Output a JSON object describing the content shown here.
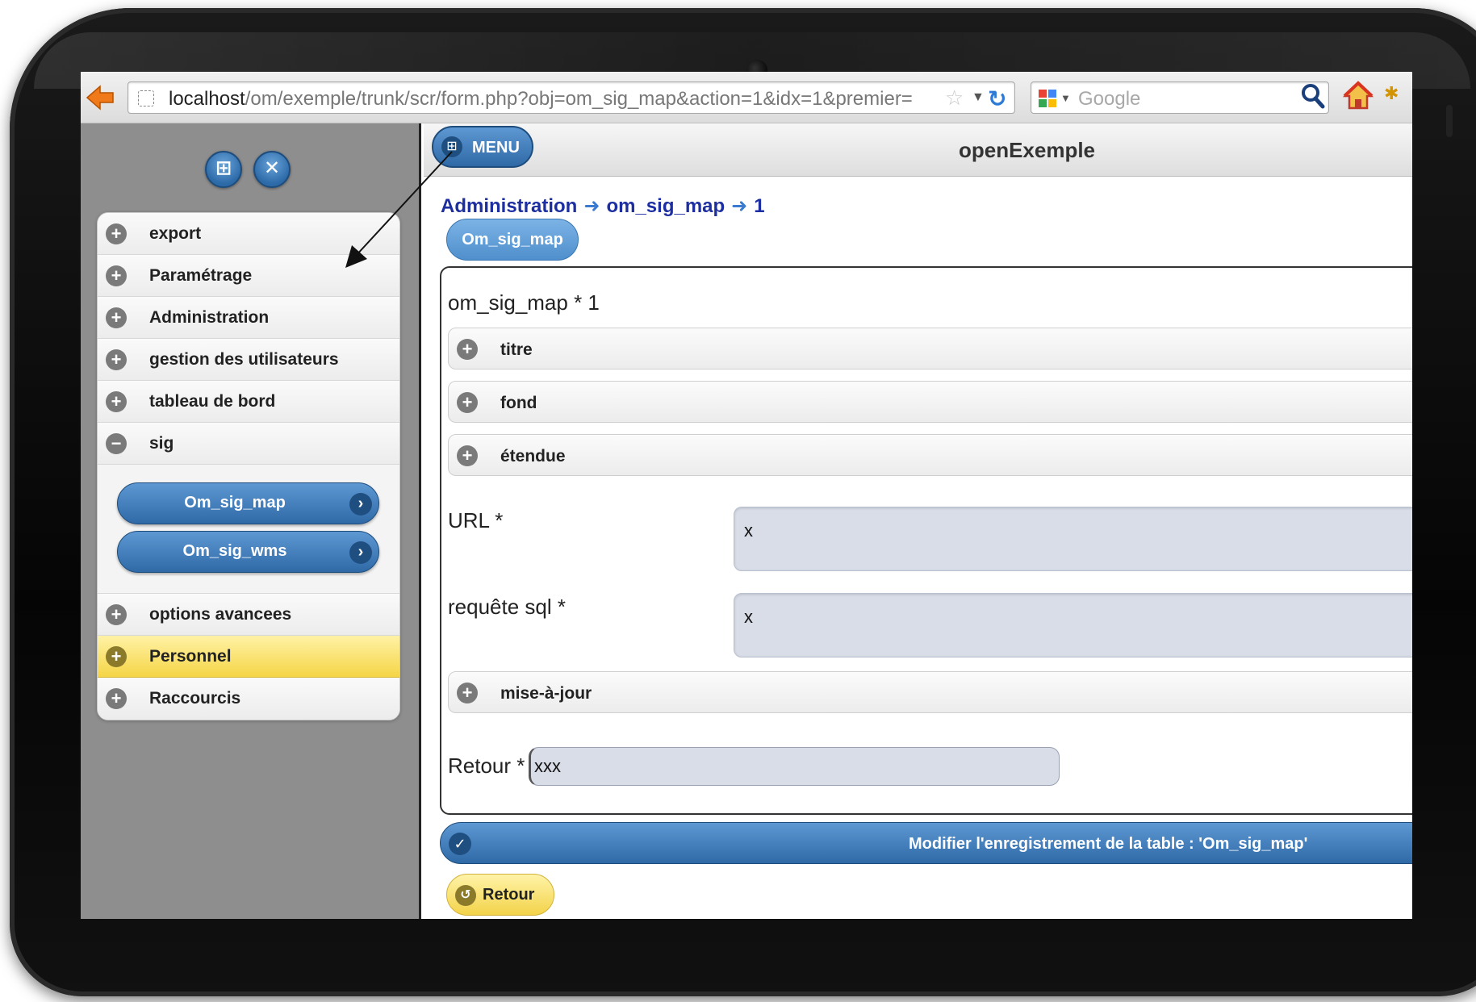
{
  "browser": {
    "url_host": "localhost",
    "url_path": "/om/exemple/trunk/scr/form.php?obj=om_sig_map&action=1&idx=1&premier=",
    "search_placeholder": "Google"
  },
  "app": {
    "menu_label": "MENU",
    "title": "openExemple"
  },
  "sidebar": {
    "items": [
      {
        "label": "export",
        "state": "collapsed"
      },
      {
        "label": "Paramétrage",
        "state": "collapsed"
      },
      {
        "label": "Administration",
        "state": "collapsed"
      },
      {
        "label": "gestion des utilisateurs",
        "state": "collapsed"
      },
      {
        "label": "tableau de bord",
        "state": "collapsed"
      },
      {
        "label": "sig",
        "state": "expanded"
      }
    ],
    "sub_items": [
      {
        "label": "Om_sig_map"
      },
      {
        "label": "Om_sig_wms"
      }
    ],
    "items_after": [
      {
        "label": "options avancees",
        "state": "collapsed"
      },
      {
        "label": "Personnel",
        "state": "collapsed",
        "highlight": true
      },
      {
        "label": "Raccourcis",
        "state": "collapsed"
      }
    ]
  },
  "breadcrumb": {
    "parts": [
      "Administration",
      "om_sig_map",
      "1"
    ]
  },
  "tab": {
    "label": "Om_sig_map"
  },
  "form": {
    "title": "om_sig_map * 1",
    "fieldsets": {
      "titre": "titre",
      "fond": "fond",
      "etendue": "étendue",
      "mise_a_jour": "mise-à-jour"
    },
    "url": {
      "label": "URL *",
      "value": "x"
    },
    "requete": {
      "label": "requête sql *",
      "value": "x"
    },
    "retour": {
      "label": "Retour *",
      "value": "xxx"
    }
  },
  "actions": {
    "submit_label": "Modifier l'enregistrement de la table : 'Om_sig_map'",
    "back_label": "Retour"
  },
  "colors": {
    "accent_blue": "#2f6aa7",
    "highlight_yellow": "#f5d546",
    "breadcrumb": "#1d2fa0"
  }
}
